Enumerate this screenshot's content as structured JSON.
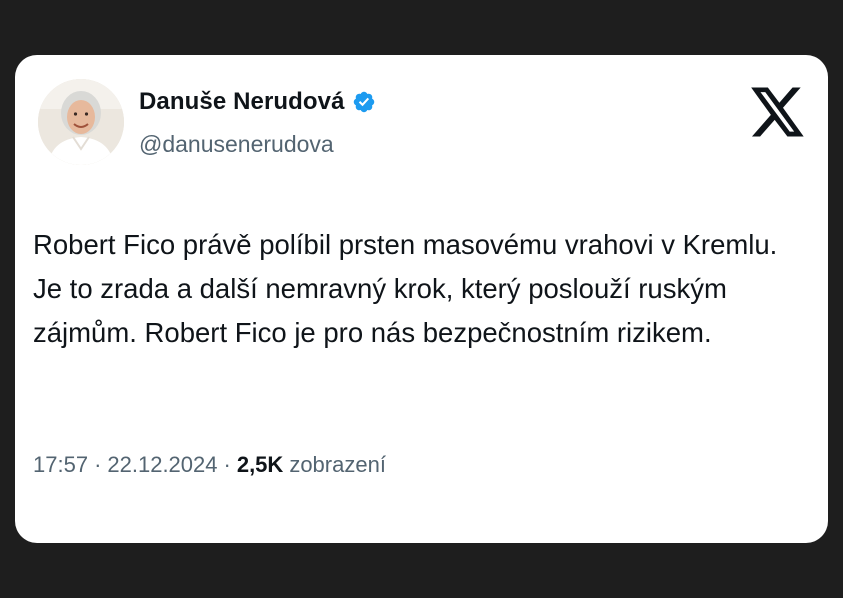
{
  "author": {
    "name": "Danuše Nerudová",
    "handle": "@danusenerudova",
    "verified": true,
    "verified_color": "#1d9bf0"
  },
  "platform_icon": "x-logo-icon",
  "tweet": {
    "text": "Robert Fico právě políbil prsten masovému vrahovi v Kremlu. Je to zrada a další nemravný krok, který poslouží ruským zájmům. Robert Fico je pro nás bezpečnostním rizikem."
  },
  "meta": {
    "time": "17:57",
    "separator": "·",
    "date": "22.12.2024",
    "views_count": "2,5K",
    "views_label": "zobrazení"
  }
}
